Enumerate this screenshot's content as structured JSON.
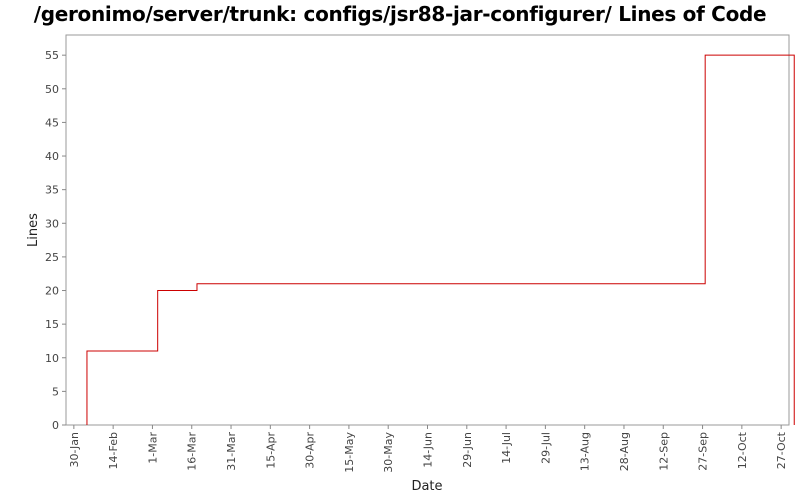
{
  "chart_data": {
    "type": "line",
    "step": true,
    "title": "/geronimo/server/trunk: configs/jsr88-jar-configurer/ Lines of Code",
    "xlabel": "Date",
    "ylabel": "Lines",
    "ylim": [
      0,
      58
    ],
    "yticks": [
      0,
      5,
      10,
      15,
      20,
      25,
      30,
      35,
      40,
      45,
      50,
      55
    ],
    "xlim": [
      -3,
      273
    ],
    "xticks": [
      {
        "label": "30-Jan",
        "day": 0
      },
      {
        "label": "14-Feb",
        "day": 15
      },
      {
        "label": "1-Mar",
        "day": 30
      },
      {
        "label": "16-Mar",
        "day": 45
      },
      {
        "label": "31-Mar",
        "day": 60
      },
      {
        "label": "15-Apr",
        "day": 75
      },
      {
        "label": "30-Apr",
        "day": 90
      },
      {
        "label": "15-May",
        "day": 105
      },
      {
        "label": "30-May",
        "day": 120
      },
      {
        "label": "14-Jun",
        "day": 135
      },
      {
        "label": "29-Jun",
        "day": 150
      },
      {
        "label": "14-Jul",
        "day": 165
      },
      {
        "label": "29-Jul",
        "day": 180
      },
      {
        "label": "13-Aug",
        "day": 195
      },
      {
        "label": "28-Aug",
        "day": 210
      },
      {
        "label": "12-Sep",
        "day": 225
      },
      {
        "label": "27-Sep",
        "day": 240
      },
      {
        "label": "12-Oct",
        "day": 255
      },
      {
        "label": "27-Oct",
        "day": 270
      }
    ],
    "series": [
      {
        "color": "#cc0000",
        "x": [
          "4-Feb",
          "4-Feb",
          "3-Mar",
          "18-Mar",
          "28-Sep",
          "1-Nov",
          "1-Nov"
        ],
        "values": [
          0,
          11,
          20,
          21,
          55,
          55,
          0
        ]
      }
    ],
    "grid": false,
    "legend": "none"
  }
}
